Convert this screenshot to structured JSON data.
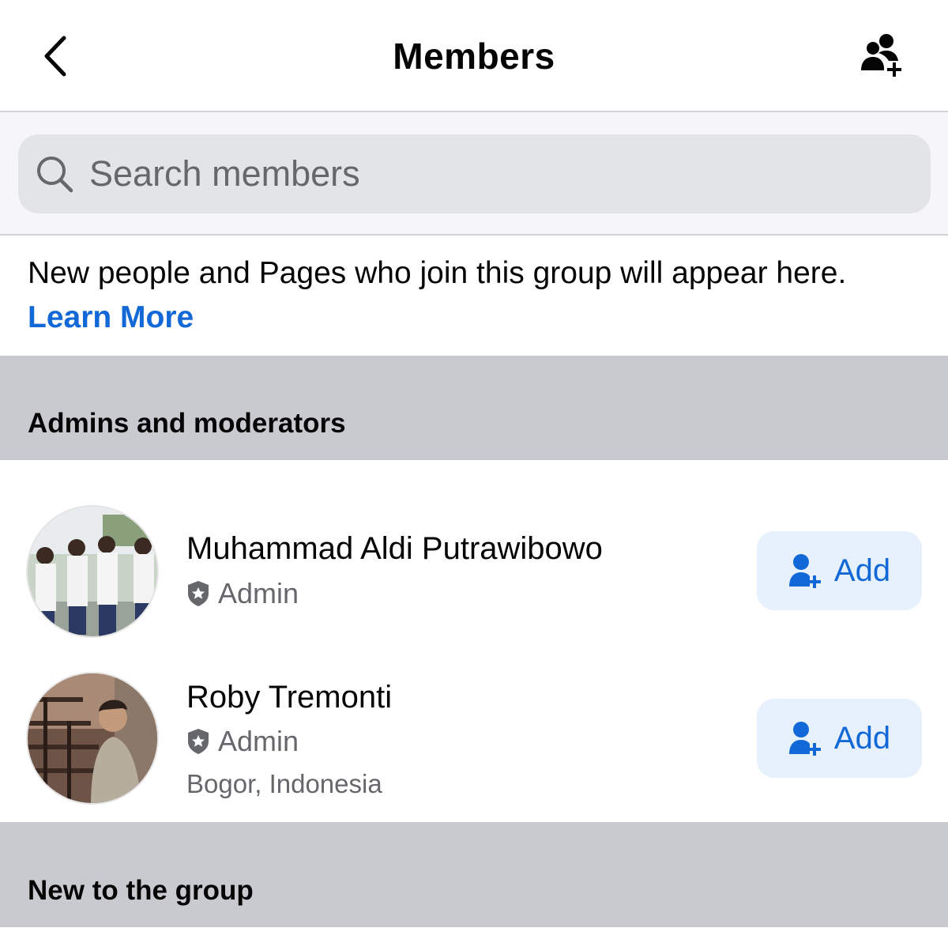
{
  "header": {
    "title": "Members",
    "back_icon": "chevron-left-icon",
    "invite_icon": "add-people-icon"
  },
  "search": {
    "placeholder": "Search members",
    "icon": "search-icon"
  },
  "info": {
    "text": "New people and Pages who join this group will appear here.",
    "link": "Learn More"
  },
  "sections": {
    "admins": "Admins and moderators",
    "new": "New to the group"
  },
  "members": [
    {
      "name": "Muhammad Aldi Putrawibowo",
      "role": "Admin",
      "location": "",
      "add_label": "Add"
    },
    {
      "name": "Roby Tremonti",
      "role": "Admin",
      "location": "Bogor, Indonesia",
      "add_label": "Add"
    }
  ],
  "colors": {
    "accent": "#1268d6",
    "add_button_bg": "#e7f1fd",
    "section_bg": "#c9cacf",
    "secondary_text": "#65676b"
  }
}
